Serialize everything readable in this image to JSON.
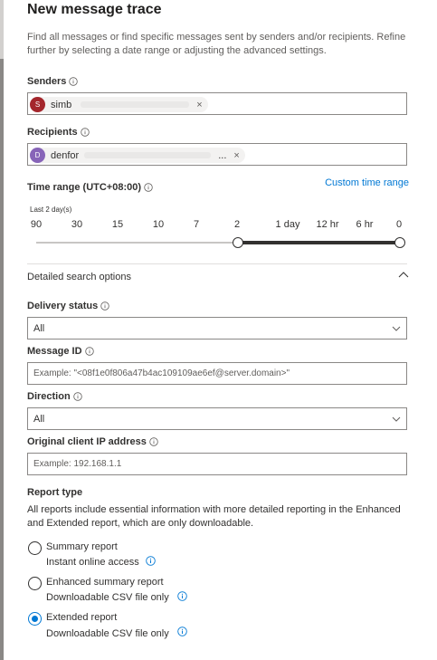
{
  "header": {
    "title": "New message trace",
    "description": "Find all messages or find specific messages sent by senders and/or recipients. Refine further by selecting a date range or adjusting the advanced settings."
  },
  "senders": {
    "label": "Senders",
    "chip": {
      "initial": "S",
      "name": "simb",
      "color": "#a4262c",
      "remove_glyph": "×"
    }
  },
  "recipients": {
    "label": "Recipients",
    "chip": {
      "initial": "D",
      "name": "denfor",
      "ellipsis": "...",
      "color": "#8764b8",
      "remove_glyph": "×"
    }
  },
  "time_range": {
    "label": "Time range (UTC+08:00)",
    "custom_link": "Custom time range",
    "selected_text": "Last 2 day(s)",
    "ticks": [
      "90",
      "30",
      "15",
      "10",
      "7",
      "2",
      "1 day",
      "12 hr",
      "6 hr",
      "0"
    ]
  },
  "detailed": {
    "title": "Detailed search options",
    "delivery_status": {
      "label": "Delivery status",
      "value": "All"
    },
    "message_id": {
      "label": "Message ID",
      "placeholder": "Example: \"<08f1e0f806a47b4ac109109ae6ef@server.domain>\""
    },
    "direction": {
      "label": "Direction",
      "value": "All"
    },
    "client_ip": {
      "label": "Original client IP address",
      "placeholder": "Example: 192.168.1.1"
    }
  },
  "report_type": {
    "label": "Report type",
    "description": "All reports include essential information with more detailed reporting in the Enhanced and Extended report, which are only downloadable.",
    "options": [
      {
        "label": "Summary report",
        "sub": "Instant online access",
        "checked": false
      },
      {
        "label": "Enhanced summary report",
        "sub": "Downloadable CSV file only",
        "checked": false
      },
      {
        "label": "Extended report",
        "sub": "Downloadable CSV file only",
        "checked": true
      }
    ]
  },
  "colors": {
    "accent": "#0078d4",
    "text": "#323130",
    "border": "#8a8886"
  }
}
